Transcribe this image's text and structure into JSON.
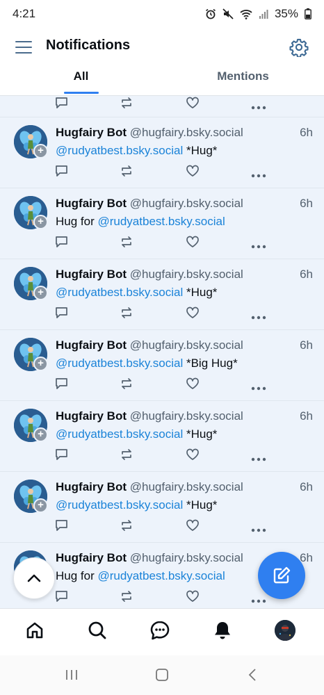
{
  "status_bar": {
    "time": "4:21",
    "battery": "35%"
  },
  "header": {
    "title": "Notifications"
  },
  "tabs": [
    {
      "label": "All"
    },
    {
      "label": "Mentions"
    }
  ],
  "notifications": [
    {
      "author": "Hugfairy Bot",
      "handle": "@hugfairy.bsky.social",
      "time": "6h",
      "prefix": "",
      "mention": "@rudyatbest.bsky.social",
      "suffix": " *Hug*"
    },
    {
      "author": "Hugfairy Bot",
      "handle": "@hugfairy.bsky.social",
      "time": "6h",
      "prefix": "Hug for ",
      "mention": "@rudyatbest.bsky.social",
      "suffix": ""
    },
    {
      "author": "Hugfairy Bot",
      "handle": "@hugfairy.bsky.social",
      "time": "6h",
      "prefix": "",
      "mention": "@rudyatbest.bsky.social",
      "suffix": " *Hug*"
    },
    {
      "author": "Hugfairy Bot",
      "handle": "@hugfairy.bsky.social",
      "time": "6h",
      "prefix": "",
      "mention": "@rudyatbest.bsky.social",
      "suffix": " *Big Hug*"
    },
    {
      "author": "Hugfairy Bot",
      "handle": "@hugfairy.bsky.social",
      "time": "6h",
      "prefix": "",
      "mention": "@rudyatbest.bsky.social",
      "suffix": " *Hug*"
    },
    {
      "author": "Hugfairy Bot",
      "handle": "@hugfairy.bsky.social",
      "time": "6h",
      "prefix": "",
      "mention": "@rudyatbest.bsky.social",
      "suffix": " *Hug*"
    },
    {
      "author": "Hugfairy Bot",
      "handle": "@hugfairy.bsky.social",
      "time": "6h",
      "prefix": "Hug for ",
      "mention": "@rudyatbest.bsky.social",
      "suffix": ""
    }
  ],
  "icons": {
    "menu": "hamburger-menu-icon",
    "settings": "gear-icon",
    "reply": "speech-bubble-icon",
    "repost": "repost-arrows-icon",
    "like": "heart-icon",
    "more": "ellipsis-icon",
    "scroll_top": "chevron-up-icon",
    "compose": "pencil-icon",
    "nav": [
      "home-icon",
      "search-icon",
      "chat-icon",
      "bell-icon",
      "profile-avatar"
    ]
  },
  "colors": {
    "accent": "#2f7ff0",
    "mention": "#1b83d8",
    "feed_background": "#edf3fb",
    "muted_text": "#53606e"
  }
}
